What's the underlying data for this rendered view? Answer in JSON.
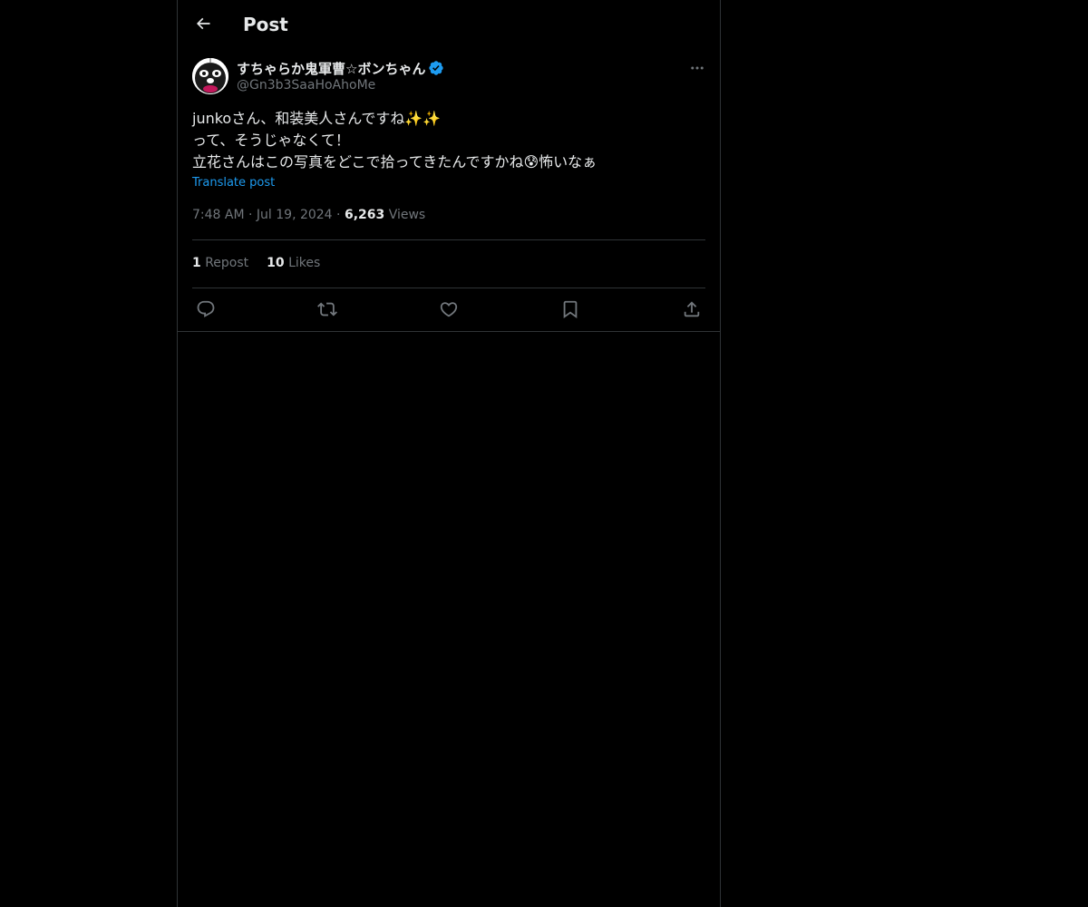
{
  "header": {
    "title": "Post",
    "back_icon": "arrow-left-icon"
  },
  "author": {
    "display_name": "すちゃらか鬼軍曹☆ボンちゃん",
    "handle": "@Gn3b3SaaHoAhoMe",
    "verified": true,
    "verified_color": "#1d9bf0"
  },
  "tweet": {
    "lines": [
      "junkoさん、和装美人さんですね✨✨",
      "って、そうじゃなくて！",
      "立花さんはこの写真をどこで拾ってきたんですかね😰怖いなぁ"
    ],
    "translate_label": "Translate post",
    "time": "7:48 AM",
    "date": "Jul 19, 2024",
    "views_count": "6,263",
    "views_label": "Views"
  },
  "stats": {
    "reposts_count": "1",
    "reposts_label": "Repost",
    "likes_count": "10",
    "likes_label": "Likes"
  },
  "actions": [
    "reply-icon",
    "repost-icon",
    "like-icon",
    "bookmark-icon",
    "share-icon"
  ],
  "colors": {
    "background": "#000000",
    "text": "#e7e9ea",
    "secondary": "#71767b",
    "accent": "#1d9bf0",
    "border": "#2f3336"
  }
}
